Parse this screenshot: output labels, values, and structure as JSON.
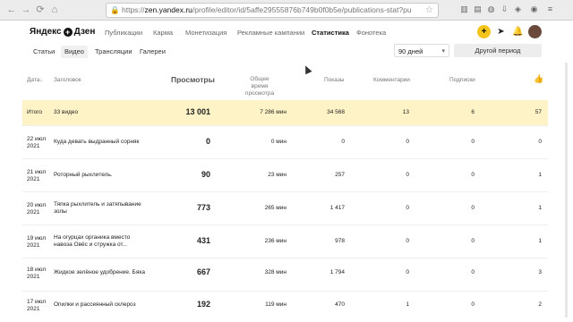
{
  "browser": {
    "url_prefix": "https://",
    "url_domain": "zen.yandex.ru",
    "url_path": "/profile/editor/id/5affe29555876b749b0f0b5e/publications-stat?pu"
  },
  "app": {
    "logo_part1": "Яндекс",
    "logo_part2": "Дзен",
    "nav": [
      "Публикации",
      "Карма",
      "Монетизация",
      "Рекламные кампании",
      "Статистика",
      "Фонотека"
    ]
  },
  "subtabs": [
    "Статьи",
    "Видео",
    "Трансляции",
    "Галереи"
  ],
  "period_select": "90 дней",
  "period_button": "Другой период",
  "columns": {
    "date": "Дата",
    "title": "Заголовок",
    "views": "Просмотры",
    "watch_time_1": "Общее время",
    "watch_time_2": "просмотра",
    "shows": "Показы",
    "comments": "Комментарии",
    "subs": "Подписки"
  },
  "total": {
    "label": "Итого",
    "title": "33 видео",
    "views": "13 001",
    "time": "7 286 мин",
    "shows": "34 568",
    "comments": "13",
    "subs": "6",
    "likes": "57"
  },
  "rows": [
    {
      "date1": "22 июл",
      "date2": "2021",
      "title1": "Куда девать выдранный сорняк",
      "title2": "",
      "views": "0",
      "time": "0 мин",
      "shows": "0",
      "comments": "0",
      "subs": "0",
      "likes": "0"
    },
    {
      "date1": "21 июл",
      "date2": "2021",
      "title1": "Роторный рыхлитель.",
      "title2": "",
      "views": "90",
      "time": "23 мин",
      "shows": "257",
      "comments": "0",
      "subs": "0",
      "likes": "1"
    },
    {
      "date1": "20 июл",
      "date2": "2021",
      "title1": "Тяпка рыхлитель и затяпывание",
      "title2": "золы",
      "views": "773",
      "time": "265 мин",
      "shows": "1 417",
      "comments": "0",
      "subs": "0",
      "likes": "1"
    },
    {
      "date1": "19 июл",
      "date2": "2021",
      "title1": "На огурцах органика вместо",
      "title2": "навоза Овёс и стружка от...",
      "views": "431",
      "time": "236 мин",
      "shows": "978",
      "comments": "0",
      "subs": "0",
      "likes": "1"
    },
    {
      "date1": "18 июл",
      "date2": "2021",
      "title1": "Жидкое зелёное удобрение. Бяка",
      "title2": "",
      "views": "667",
      "time": "328 мин",
      "shows": "1 794",
      "comments": "0",
      "subs": "0",
      "likes": "3"
    },
    {
      "date1": "17 июл",
      "date2": "2021",
      "title1": "Опилки и рассеянный склероз",
      "title2": "",
      "views": "192",
      "time": "119 мин",
      "shows": "470",
      "comments": "1",
      "subs": "0",
      "likes": "2"
    }
  ]
}
